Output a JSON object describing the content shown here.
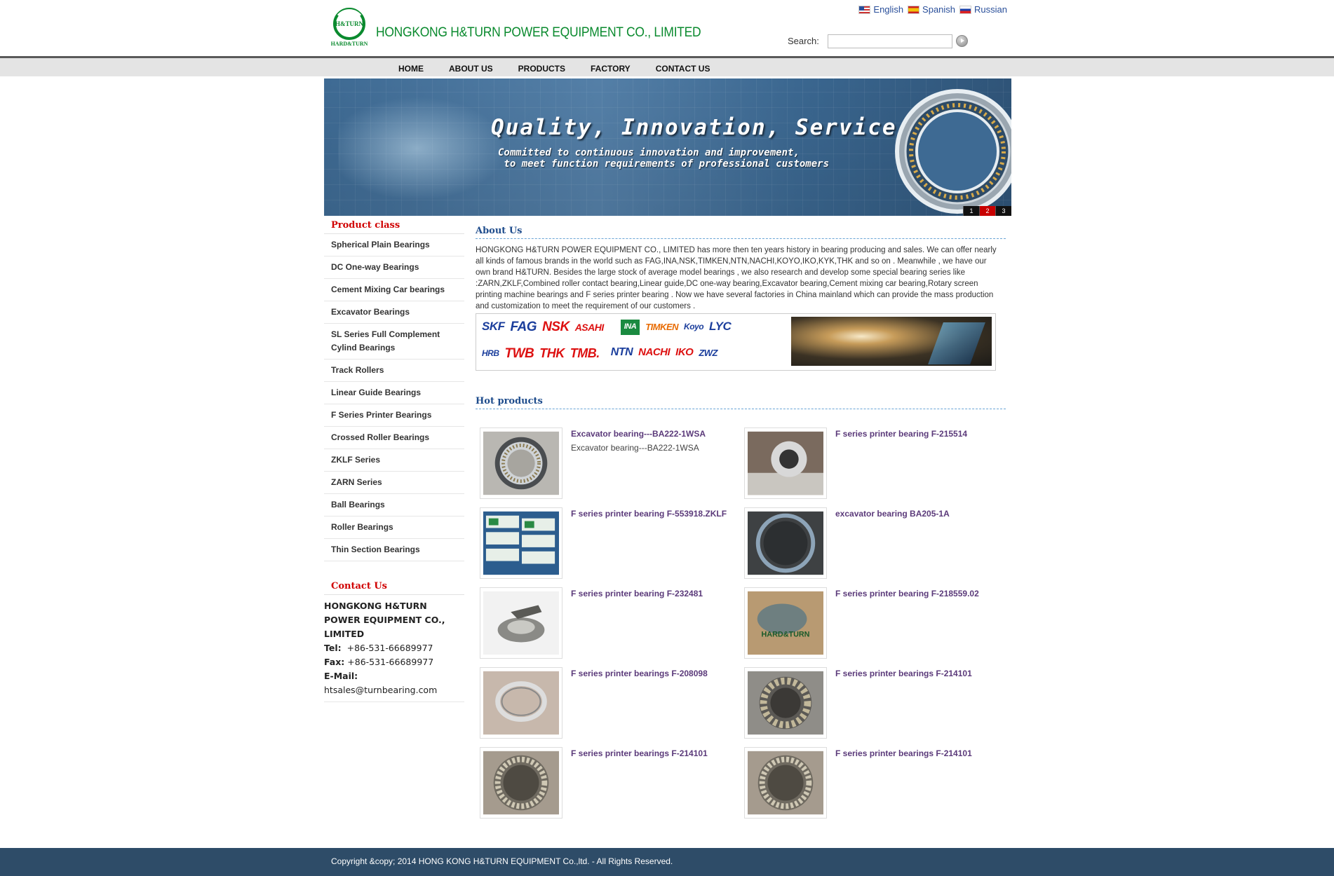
{
  "header": {
    "logo_text_top": "H&TURN",
    "logo_text_bottom": "HARD&TURN",
    "company_name": "HONGKONG H&TURN POWER EQUIPMENT CO., LIMITED",
    "languages": [
      "English",
      "Spanish",
      "Russian"
    ],
    "search_label": "Search:",
    "search_value": ""
  },
  "nav": [
    "HOME",
    "ABOUT US",
    "PRODUCTS",
    "FACTORY",
    "CONTACT US"
  ],
  "banner": {
    "title": "Quality, Innovation, Service",
    "subtitle": "Committed to continuous innovation and improvement,\n to meet function requirements of professional customers",
    "pages": [
      "1",
      "2",
      "3"
    ],
    "active_page": 2
  },
  "sidebar": {
    "product_heading": "Product class",
    "product_items": [
      "Spherical Plain Bearings",
      "DC One-way Bearings",
      "Cement Mixing Car bearings",
      "Excavator Bearings",
      "SL Series Full Complement Cylind Bearings",
      "Track Rollers",
      "Linear Guide Bearings",
      "F Series Printer Bearings",
      "Crossed Roller Bearings",
      "ZKLF Series",
      "ZARN Series",
      "Ball Bearings",
      "Roller Bearings",
      "Thin Section Bearings"
    ],
    "contact_heading": "Contact Us",
    "contact": {
      "company": "HONGKONG H&TURN POWER EQUIPMENT CO., LIMITED",
      "tel_label": "Tel:",
      "tel": "+86-531-66689977",
      "fax_label": "Fax:",
      "fax": "+86-531-66689977",
      "email_label": "E-Mail:",
      "email": "htsales@turnbearing.com"
    }
  },
  "about": {
    "heading": "About Us",
    "text": "HONGKONG H&TURN POWER EQUIPMENT CO., LIMITED has more then ten years history in bearing producing and sales. We can offer nearly all kinds of famous brands in the world such as FAG,INA,NSK,TIMKEN,NTN,NACHI,KOYO,IKO,KYK,THK and so on . Meanwhile , we have our own brand  H&TURN.  Besides the large stock of average model bearings , we also research and develop some special bearing series like :ZARN,ZKLF,Combined roller contact bearing,Linear guide,DC one-way bearing,Excavator bearing,Cement mixing car bearing,Rotary screen printing machine bearings and F series printer bearing . Now we have several factories in China mainland which can provide the mass production and customization to meet the requirement of our customers .",
    "brands_row1": [
      "SKF",
      "FAG",
      "NSK",
      "ASAHI",
      "INA",
      "TIMKEN",
      "Koyo",
      "LYC"
    ],
    "brands_row2": [
      "HRB",
      "TWB",
      "THK",
      "TMB.",
      "NTN",
      "NACHI",
      "IKO",
      "ZWZ"
    ]
  },
  "hot_products": {
    "heading": "Hot products",
    "items": [
      {
        "name": "Excavator bearing---BA222-1WSA",
        "desc": "Excavator bearing---BA222-1WSA",
        "img": "ring"
      },
      {
        "name": "F series printer bearing F-215514",
        "desc": "",
        "img": "caliper"
      },
      {
        "name": "F series printer bearing F-553918.ZKLF",
        "desc": "",
        "img": "boxes"
      },
      {
        "name": "excavator bearing BA205-1A",
        "desc": "",
        "img": "ring-dark"
      },
      {
        "name": "F series printer bearing F-232481",
        "desc": "",
        "img": "assembly"
      },
      {
        "name": "F series printer bearing F-218559.02",
        "desc": "",
        "img": "package"
      },
      {
        "name": "F series printer bearings F-208098",
        "desc": "",
        "img": "thin-ring"
      },
      {
        "name": "F series printer bearings F-214101",
        "desc": "",
        "img": "roller"
      },
      {
        "name": "F series printer bearings F-214101",
        "desc": "",
        "img": "ring-rollers"
      },
      {
        "name": "F series printer bearings F-214101",
        "desc": "",
        "img": "ring-rollers"
      }
    ]
  },
  "footer": {
    "copyright": "Copyright &copy; 2014 HONG KONG H&TURN EQUIPMENT Co.,ltd. - All Rights Reserved."
  }
}
